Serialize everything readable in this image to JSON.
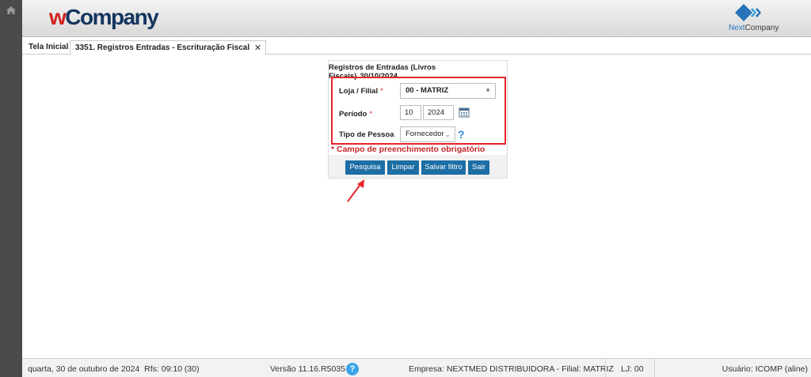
{
  "header": {
    "logo_prefix": "w",
    "logo_main": "Company",
    "brand_logo_prefix": "Next",
    "brand_logo_suffix": "Company"
  },
  "tabs": [
    {
      "label": "Tela Inicial"
    },
    {
      "label": "3351. Registros Entradas - Escrituração Fiscal",
      "close": "✕"
    }
  ],
  "form": {
    "title": "Registros de Entradas (Livros Fiscais)",
    "date": "30/10/2024",
    "fields": {
      "loja": {
        "label": "Loja / Filial",
        "required_mark": "*",
        "value": "00 - MATRIZ"
      },
      "periodo": {
        "label": "Período",
        "required_mark": "*",
        "month": "10",
        "year": "2024"
      },
      "tipo_pessoa": {
        "label": "Tipo de Pessoa",
        "value": "Fornecedor",
        "help": "?"
      }
    },
    "required_note": "* Campo de preenchimento obrigatório",
    "buttons": {
      "search": "Pesquisa",
      "clear": "Limpar",
      "save_filter": "Salvar filtro",
      "exit": "Sair"
    }
  },
  "status": {
    "date": "quarta, 30 de outubro de 2024",
    "rfs": "Rfs: 09:10 (30)",
    "version": "Versão 11.16.R5035",
    "help": "?",
    "company": "Empresa: NEXTMED DISTRIBUIDORA - Filial: MATRIZ",
    "lj": "LJ: 00",
    "user": "Usuário: ICOMP (aline)"
  },
  "colors": {
    "accent_button": "#1c6ea4",
    "required_red": "#e8232a",
    "logo_red": "#d2201d",
    "logo_navy": "#14355e",
    "help_blue": "#3aa4e8"
  }
}
